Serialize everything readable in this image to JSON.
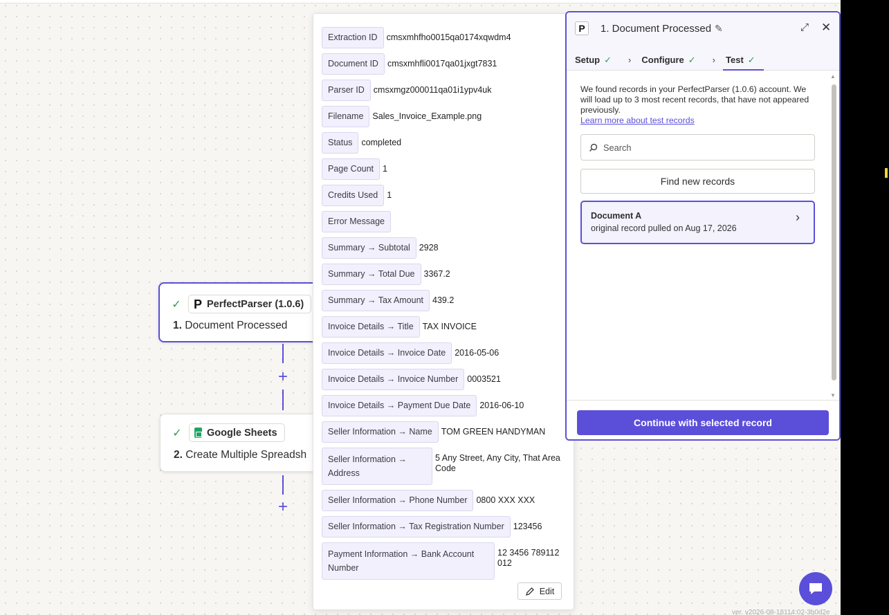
{
  "canvas": {
    "step1": {
      "app": "PerfectParser (1.0.6)",
      "num": "1.",
      "title": "Document Processed"
    },
    "step2": {
      "app": "Google Sheets",
      "num": "2.",
      "title": "Create Multiple Spreadsh"
    }
  },
  "popup": {
    "rows": [
      {
        "key": "Extraction ID",
        "value": "cmsxmhfho0015qa0174xqwdm4"
      },
      {
        "key": "Document ID",
        "value": "cmsxmhfli0017qa01jxgt7831"
      },
      {
        "key": "Parser ID",
        "value": "cmsxmgz000011qa01i1ypv4uk"
      },
      {
        "key": "Filename",
        "value": "Sales_Invoice_Example.png"
      },
      {
        "key": "Status",
        "value": "completed"
      },
      {
        "key": "Page Count",
        "value": "1"
      },
      {
        "key": "Credits Used",
        "value": "1"
      },
      {
        "key": "Error Message",
        "value": ""
      },
      {
        "key": "Summary → Subtotal",
        "value": "2928"
      },
      {
        "key": "Summary → Total Due",
        "value": "3367.2"
      },
      {
        "key": "Summary → Tax Amount",
        "value": "439.2"
      },
      {
        "key": "Invoice Details → Title",
        "value": "TAX INVOICE"
      },
      {
        "key": "Invoice Details → Invoice Date",
        "value": "2016-05-06"
      },
      {
        "key": "Invoice Details → Invoice Number",
        "value": "0003521"
      },
      {
        "key": "Invoice Details → Payment Due Date",
        "value": "2016-06-10"
      },
      {
        "key": "Seller Information → Name",
        "value": "TOM GREEN HANDYMAN"
      },
      {
        "key": "Seller Information → Address",
        "value": "5 Any Street, Any City, That Area Code"
      },
      {
        "key": "Seller Information → Phone Number",
        "value": "0800 XXX XXX"
      },
      {
        "key": "Seller Information → Tax Registration Number",
        "value": "123456"
      },
      {
        "key": "Payment Information → Bank Account Number",
        "value": "12 3456 789112 012"
      }
    ],
    "edit_label": "Edit"
  },
  "panel": {
    "title": "1. Document Processed",
    "tabs": [
      {
        "label": "Setup"
      },
      {
        "label": "Configure"
      },
      {
        "label": "Test"
      }
    ],
    "intro": "We found records in your PerfectParser (1.0.6) account. We will load up to 3 most recent records, that have not appeared previously.",
    "learn_more": "Learn more about test records",
    "search_placeholder": "Search",
    "find_button": "Find new records",
    "record": {
      "name": "Document A",
      "subtitle": "original record pulled on Aug 17, 2026"
    },
    "continue_button": "Continue with selected record"
  },
  "footer": {
    "version": "ver. v2026-08-18114:02-3b0d2e"
  },
  "colors": {
    "accent": "#5b4fd9",
    "success": "#2e9e4a"
  },
  "icons": [
    "check-icon",
    "perfectparser-logo-icon",
    "google-sheets-icon",
    "plus-icon",
    "edit-pencil-icon",
    "expand-icon",
    "close-icon",
    "chevron-right-icon",
    "search-icon",
    "chat-icon"
  ]
}
